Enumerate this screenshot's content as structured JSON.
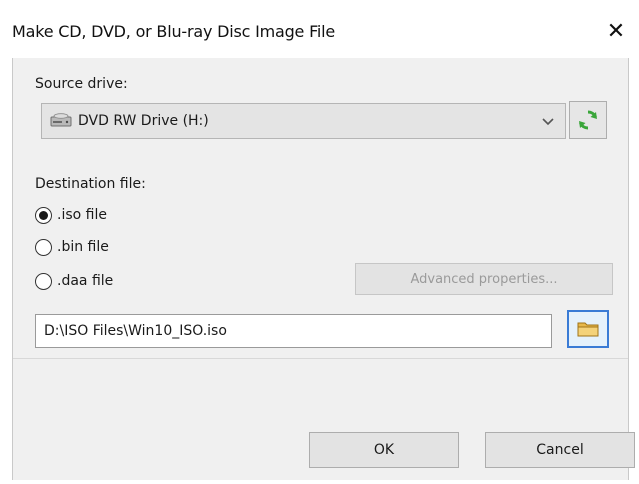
{
  "window": {
    "title": "Make CD, DVD, or Blu-ray Disc Image File",
    "close_symbol": "✕"
  },
  "source": {
    "label": "Source drive:",
    "selected": "DVD RW Drive (H:)",
    "drive_icon": "optical-drive-icon",
    "refresh_icon": "refresh-icon"
  },
  "destination": {
    "label": "Destination file:",
    "options": [
      {
        "label": ".iso file",
        "selected": true
      },
      {
        "label": ".bin file",
        "selected": false
      },
      {
        "label": ".daa file",
        "selected": false
      }
    ],
    "advanced_label": "Advanced properties...",
    "path": "D:\\ISO Files\\Win10_ISO.iso",
    "browse_icon": "folder-icon"
  },
  "buttons": {
    "ok": "OK",
    "cancel": "Cancel"
  },
  "colors": {
    "accent": "#3a7bd5",
    "refresh_green": "#3aa63a",
    "folder_yellow": "#e8b84a"
  }
}
